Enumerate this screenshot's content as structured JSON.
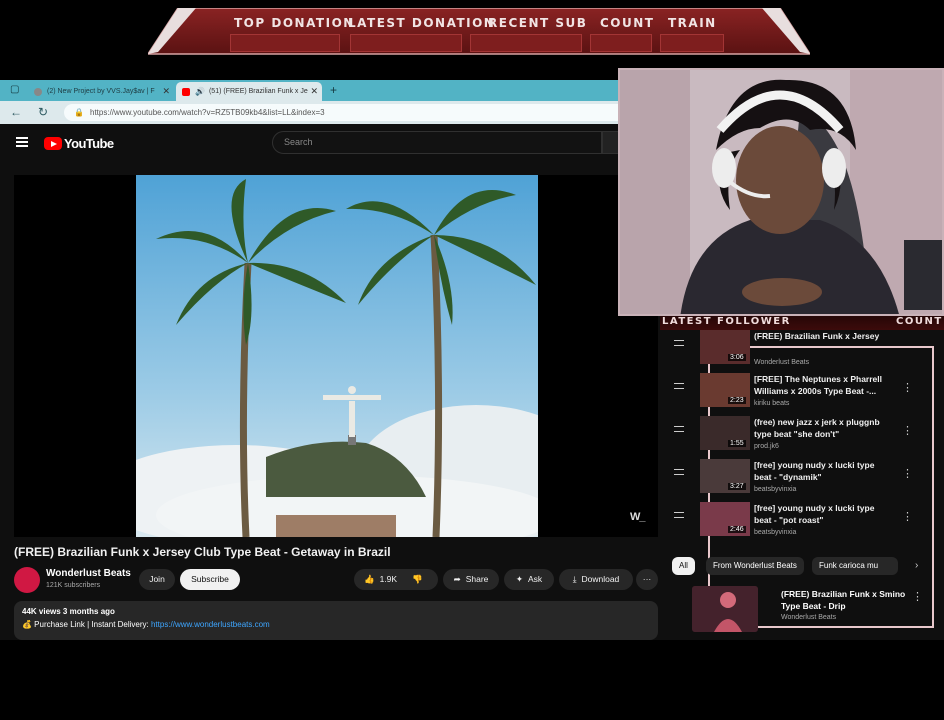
{
  "overlay": {
    "banner_labels": [
      "TOP DONATION",
      "LATEST DONATION",
      "RECENT SUB",
      "COUNT",
      "TRAIN"
    ],
    "follower_labels": [
      "LATEST FOLLOWER",
      "COUNT"
    ],
    "accent_color": "#b52a2a"
  },
  "browser": {
    "tabs": [
      {
        "label": "(2) New Project by VVS.Jay$av | F",
        "icon": "tab-favicon"
      },
      {
        "label": "(51) (FREE) Brazilian Funk x Je",
        "icon": "youtube-favicon",
        "muted_icon": "speaker-icon",
        "active": true
      }
    ],
    "url": "https://www.youtube.com/watch?v=RZ5TB09kb4&list=LL&index=3",
    "new_tab_symbol": "+"
  },
  "youtube": {
    "logo_text": "YouTube",
    "search_placeholder": "Search",
    "watermark": "W_",
    "video_title": "(FREE) Brazilian Funk x Jersey Club Type Beat - Getaway in Brazil",
    "channel": {
      "name": "Wonderlust Beats",
      "subscribers": "121K subscribers"
    },
    "buttons": {
      "join": "Join",
      "subscribe": "Subscribe",
      "likes": "1.9K",
      "share": "Share",
      "ask": "Ask",
      "download": "Download",
      "more": "···"
    },
    "description": {
      "meta": "44K views  3 months ago",
      "line_prefix": "💰 Purchase Link | Instant Delivery: ",
      "link": "https://www.wonderlustbeats.com"
    }
  },
  "playlist": {
    "items": [
      {
        "title": "(FREE) Brazilian Funk x Jersey",
        "channel": "Wonderlust Beats",
        "duration": "3:06"
      },
      {
        "title": "[FREE] The Neptunes x Pharrell Williams x 2000s Type Beat -...",
        "channel": "kiriku beats",
        "duration": "2:23"
      },
      {
        "title": "(free) new jazz x jerk x pluggnb type beat \"she don't\"",
        "channel": "prod.jk6",
        "duration": "1:55"
      },
      {
        "title": "[free] young nudy x lucki type beat - \"dynamik\"",
        "channel": "beatsbyvinxia",
        "duration": "3:27"
      },
      {
        "title": "[free] young nudy x lucki type beat - \"pot roast\"",
        "channel": "beatsbyvinxia",
        "duration": "2:46"
      }
    ],
    "more_symbol": "⋮"
  },
  "chips": [
    "All",
    "From Wonderlust Beats",
    "Funk carioca mu"
  ],
  "recommended": {
    "title": "(FREE) Brazilian Funk x Smino Type Beat - Drip",
    "channel": "Wonderlust Beats"
  }
}
